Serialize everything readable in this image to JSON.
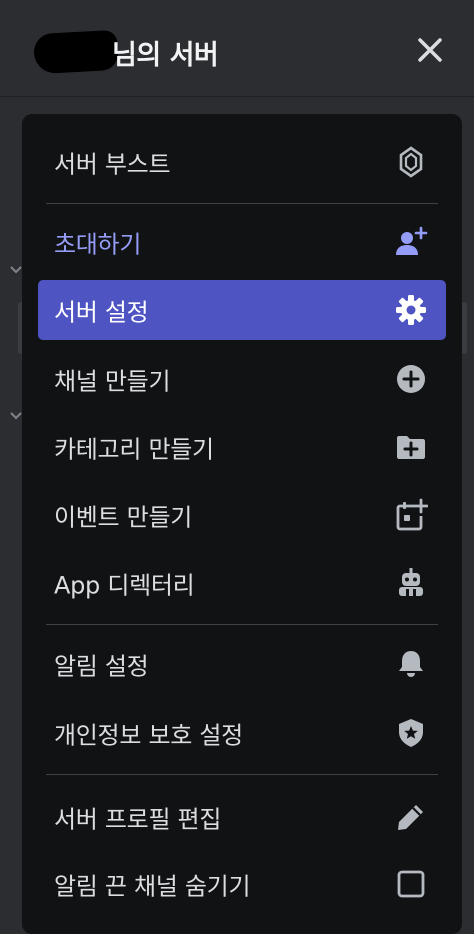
{
  "header": {
    "title": "님의 서버"
  },
  "menu": {
    "items": [
      {
        "id": "server-boost",
        "label": "서버 부스트",
        "icon": "boost-gem-icon"
      },
      {
        "id": "invite",
        "label": "초대하기",
        "icon": "add-person-icon"
      },
      {
        "id": "server-settings",
        "label": "서버 설정",
        "icon": "gear-icon",
        "active": true
      },
      {
        "id": "create-channel",
        "label": "채널 만들기",
        "icon": "plus-circle-icon"
      },
      {
        "id": "create-category",
        "label": "카테고리 만들기",
        "icon": "folder-plus-icon"
      },
      {
        "id": "create-event",
        "label": "이벤트 만들기",
        "icon": "calendar-plus-icon"
      },
      {
        "id": "app-directory",
        "label": "App 디렉터리",
        "icon": "robot-icon"
      },
      {
        "id": "notification-settings",
        "label": "알림 설정",
        "icon": "bell-icon"
      },
      {
        "id": "privacy-settings",
        "label": "개인정보 보호 설정",
        "icon": "shield-star-icon"
      },
      {
        "id": "edit-server-profile",
        "label": "서버 프로필 편집",
        "icon": "pencil-icon"
      },
      {
        "id": "hide-muted-channels",
        "label": "알림 끈 채널 숨기기",
        "icon": "checkbox-icon"
      }
    ]
  },
  "colors": {
    "menu_bg": "#111214",
    "active_bg": "#4e55c3",
    "invite_text": "#949cf7",
    "text": "#dbdee1",
    "icon": "#b5bac1"
  }
}
